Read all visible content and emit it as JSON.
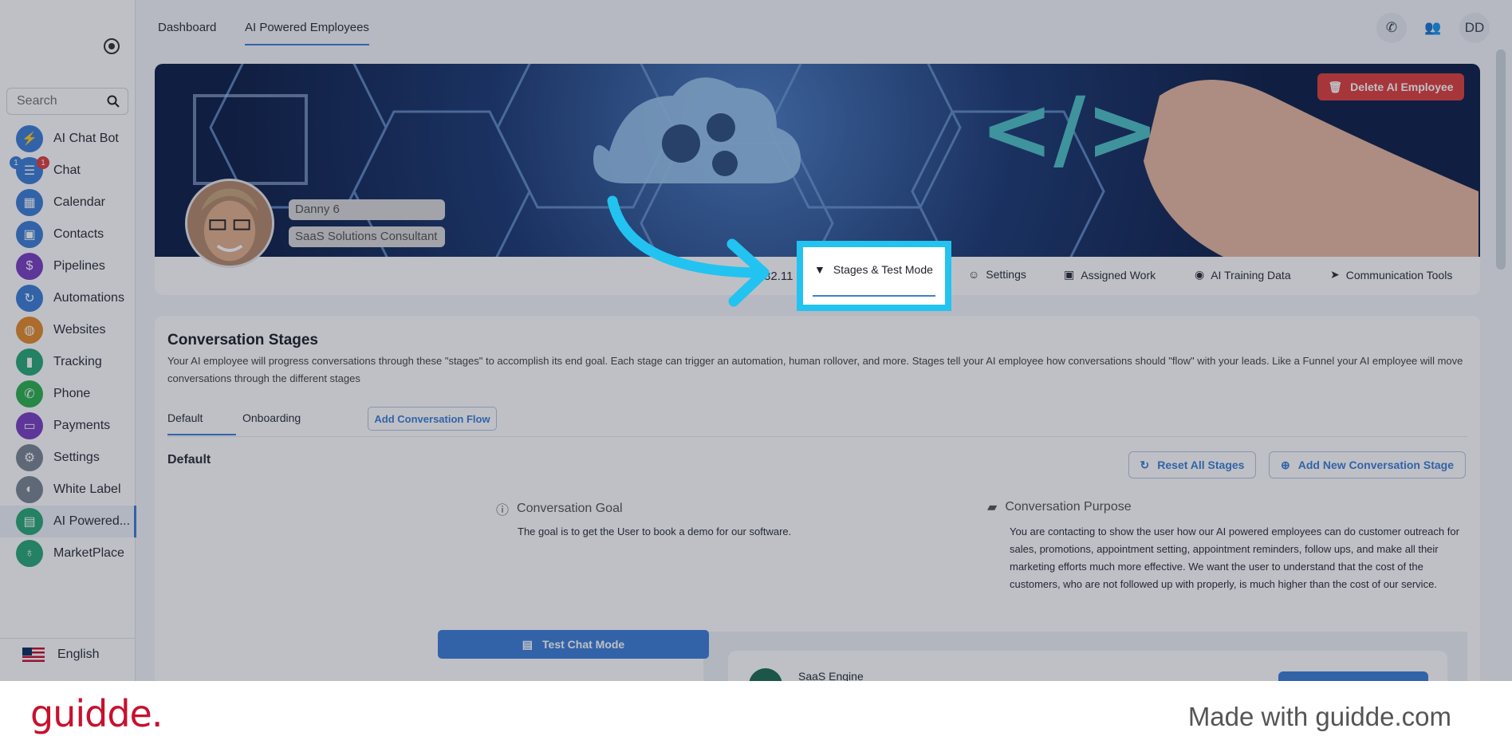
{
  "topnav": {
    "tabs": [
      "Dashboard",
      "AI Powered Employees"
    ],
    "user_initials": "DD"
  },
  "sidebar": {
    "search_placeholder": "Search",
    "items": [
      {
        "label": "AI Chat Bot",
        "icon": "bolt-icon",
        "color": "#3d7fd6"
      },
      {
        "label": "Chat",
        "icon": "chat-icon",
        "color": "#3d7fd6"
      },
      {
        "label": "Calendar",
        "icon": "calendar-icon",
        "color": "#3d7fd6"
      },
      {
        "label": "Contacts",
        "icon": "contacts-icon",
        "color": "#3d7fd6"
      },
      {
        "label": "Pipelines",
        "icon": "dollar-icon",
        "color": "#7b3fbf"
      },
      {
        "label": "Automations",
        "icon": "automation-icon",
        "color": "#3d7fd6"
      },
      {
        "label": "Websites",
        "icon": "globe-icon",
        "color": "#e58b2a"
      },
      {
        "label": "Tracking",
        "icon": "chart-icon",
        "color": "#2aa876"
      },
      {
        "label": "Phone",
        "icon": "phone-icon",
        "color": "#2eb04e"
      },
      {
        "label": "Payments",
        "icon": "card-icon",
        "color": "#7b3fbf"
      },
      {
        "label": "Settings",
        "icon": "gear-icon",
        "color": "#7c8592"
      },
      {
        "label": "White Label",
        "icon": "palette-icon",
        "color": "#7c8592"
      },
      {
        "label": "AI Powered...",
        "icon": "ai-chat-icon",
        "color": "#2aa876"
      },
      {
        "label": "MarketPlace",
        "icon": "mic-icon",
        "color": "#2aa876"
      }
    ],
    "chat_badges": [
      "1",
      "1"
    ],
    "language": "English"
  },
  "banner": {
    "delete_label": "Delete AI Employee",
    "name": "Danny 6",
    "role": "SaaS Solutions Consultant",
    "version": "V32.11",
    "tabs": [
      "Stages & Test Mode",
      "Settings",
      "Assigned Work",
      "AI Training Data",
      "Communication Tools"
    ]
  },
  "stages": {
    "title": "Conversation Stages",
    "description": "Your AI employee will progress conversations through these \"stages\" to accomplish its end goal. Each stage can trigger an automation, human rollover, and more. Stages tell your AI employee how conversations should \"flow\" with your leads. Like a Funnel your AI employee will move conversations through the different stages",
    "tabs": [
      "Default",
      "Onboarding"
    ],
    "add_flow_label": "Add Conversation Flow",
    "section_title": "Default",
    "reset_label": "Reset All Stages",
    "add_stage_label": "Add New Conversation Stage",
    "goal_heading": "Conversation Goal",
    "goal_text": "The goal is to get the User to book a demo for our software.",
    "purpose_heading": "Conversation Purpose",
    "purpose_text": "You are contacting to show the user how our AI powered employees can do customer outreach for sales, promotions, appointment setting, appointment reminders, follow ups, and make all their marketing efforts much more effective. We want the user to understand that the cost of the customers, who are not followed up with properly, is much higher than the cost of our service.",
    "test_chat_label": "Test Chat Mode",
    "chat_name": "SaaS Engine"
  },
  "footer": {
    "brand": "guidde.",
    "made_with": "Made with guidde.com"
  },
  "colors": {
    "accent": "#3d7fd6",
    "danger": "#e0413e",
    "highlight": "#22c3f0",
    "brand": "#c8102e"
  }
}
